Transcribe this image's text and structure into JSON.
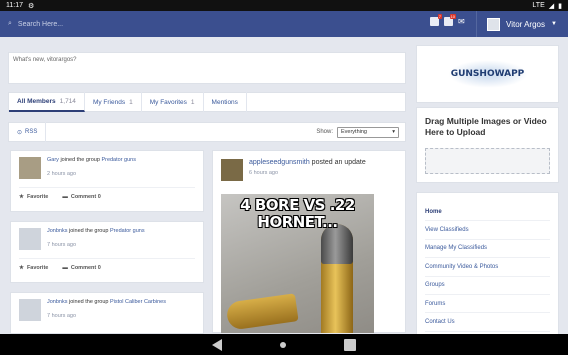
{
  "status": {
    "time": "11:17",
    "network": "LTE"
  },
  "topbar": {
    "search_placeholder": "Search Here...",
    "user_name": "Vitor Argos",
    "badges": [
      "7",
      "10"
    ]
  },
  "whats_new": {
    "placeholder": "What's new, vitorargos?"
  },
  "tabs": [
    {
      "label": "All Members",
      "count": "1,714"
    },
    {
      "label": "My Friends",
      "count": "1"
    },
    {
      "label": "My Favorites",
      "count": "1"
    },
    {
      "label": "Mentions",
      "count": ""
    }
  ],
  "filter": {
    "rss": "RSS",
    "show_label": "Show:",
    "show_value": "Everything"
  },
  "activities": [
    {
      "user": "Gary",
      "text": "joined the group",
      "group": "Predator guns",
      "time": "2 hours ago",
      "favorite": "Favorite",
      "comment": "Comment 0"
    },
    {
      "user": "Jonbnks",
      "text": "joined the group",
      "group": "Predator guns",
      "time": "7 hours ago",
      "favorite": "Favorite",
      "comment": "Comment 0"
    },
    {
      "user": "Jonbnks",
      "text": "joined the group",
      "group": "Pistol Caliber Carbines",
      "time": "7 hours ago"
    }
  ],
  "feature_post": {
    "user": "appleseedgunsmith",
    "action": "posted an update",
    "time": "6 hours ago",
    "caption": "4 BORE VS .22 HORNET..."
  },
  "sidebar": {
    "logo_text": "GUNSHOWAPP",
    "upload_title": "Drag Multiple Images or Video Here to Upload",
    "menu": [
      "Home",
      "View Classifieds",
      "Manage My Classifieds",
      "Community Video & Photos",
      "Groups",
      "Forums",
      "Contact Us"
    ]
  }
}
